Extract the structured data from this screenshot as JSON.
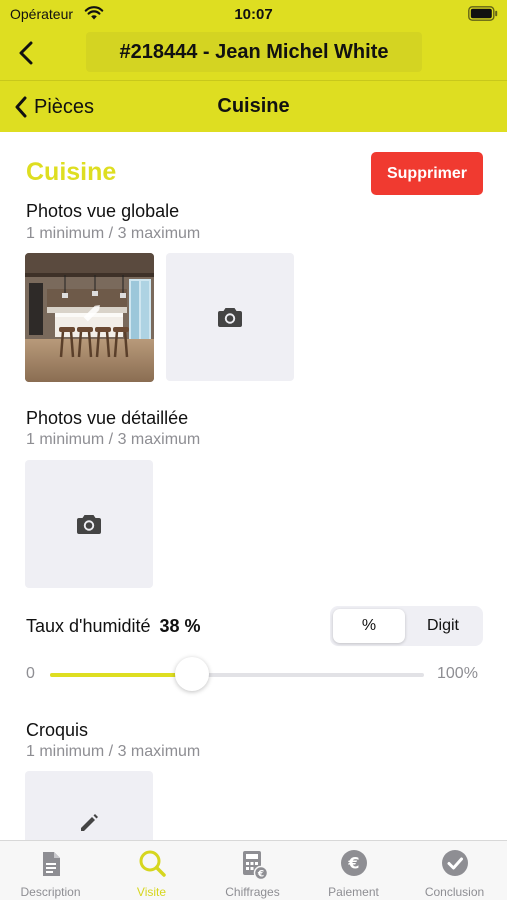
{
  "status_bar": {
    "carrier": "Opérateur",
    "time": "10:07"
  },
  "header": {
    "title": "#218444 - Jean Michel White"
  },
  "sub_nav": {
    "back_label": "Pièces",
    "title": "Cuisine"
  },
  "room": {
    "title": "Cuisine",
    "delete_label": "Supprimer",
    "photos_global": {
      "label": "Photos vue globale",
      "hint": "1 minimum / 3 maximum"
    },
    "photos_detail": {
      "label": "Photos vue détaillée",
      "hint": "1 minimum / 3 maximum"
    },
    "humidity": {
      "label": "Taux d'humidité",
      "value": "38 %",
      "level": 0.38,
      "mode_options": [
        "%",
        "Digit"
      ],
      "selected_mode": "%",
      "min_label": "0",
      "max_label": "100%"
    },
    "sketch": {
      "label": "Croquis",
      "hint": "1 minimum / 3 maximum"
    }
  },
  "tabs": [
    {
      "label": "Description",
      "icon": "document-icon",
      "active": false
    },
    {
      "label": "Visite",
      "icon": "search-icon",
      "active": true
    },
    {
      "label": "Chiffrages",
      "icon": "calculator-icon",
      "active": false
    },
    {
      "label": "Paiement",
      "icon": "euro-icon",
      "active": false
    },
    {
      "label": "Conclusion",
      "icon": "checkmark-icon",
      "active": false
    }
  ],
  "colors": {
    "accent": "#dede21",
    "danger": "#f03a30",
    "placeholder_bg": "#efeff4",
    "muted_text": "#8e8e93"
  }
}
